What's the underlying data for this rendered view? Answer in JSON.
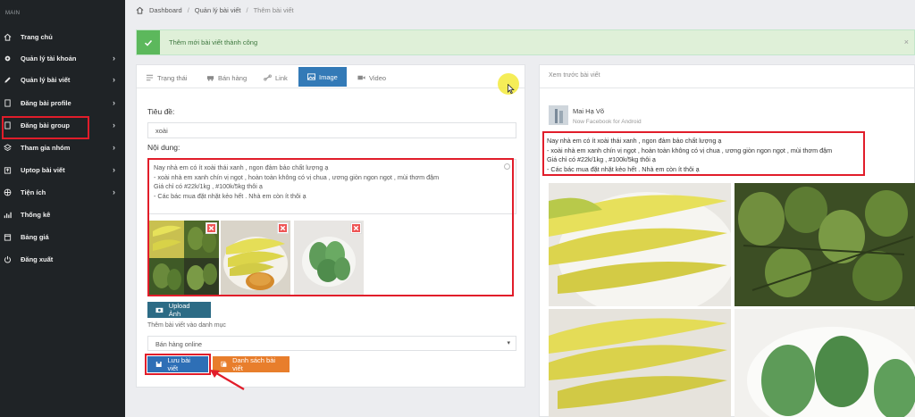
{
  "sidebar": {
    "section_label": "MAIN",
    "items": [
      {
        "label": "Trang chủ",
        "icon": "home-icon",
        "has_chevron": false
      },
      {
        "label": "Quản lý tài khoản",
        "icon": "gear-icon",
        "has_chevron": true
      },
      {
        "label": "Quản lý bài viết",
        "icon": "pencil-icon",
        "has_chevron": true
      },
      {
        "label": "Đăng bài profile",
        "icon": "document-icon",
        "has_chevron": true
      },
      {
        "label": "Đăng bài group",
        "icon": "document-icon",
        "has_chevron": true,
        "highlighted": true
      },
      {
        "label": "Tham gia nhóm",
        "icon": "layers-icon",
        "has_chevron": true
      },
      {
        "label": "Uptop bài viết",
        "icon": "upload-icon",
        "has_chevron": true
      },
      {
        "label": "Tiện ích",
        "icon": "globe-icon",
        "has_chevron": true
      },
      {
        "label": "Thống kê",
        "icon": "chart-icon",
        "has_chevron": false
      },
      {
        "label": "Bảng giá",
        "icon": "calendar-icon",
        "has_chevron": false
      },
      {
        "label": "Đăng xuất",
        "icon": "power-icon",
        "has_chevron": false
      }
    ]
  },
  "breadcrumb": {
    "home": "Dashboard",
    "section": "Quản lý bài viết",
    "current": "Thêm bài viết"
  },
  "alert": {
    "message": "Thêm mới bài viết thành công",
    "close": "×"
  },
  "tabs": [
    {
      "label": "Trạng thái",
      "icon": "status-icon"
    },
    {
      "label": "Bán hàng",
      "icon": "car-icon"
    },
    {
      "label": "Link",
      "icon": "link-icon"
    },
    {
      "label": "Image",
      "icon": "image-icon",
      "active": true
    },
    {
      "label": "Video",
      "icon": "video-icon"
    }
  ],
  "form": {
    "title_label": "Tiêu đề:",
    "title_value": "xoài",
    "content_label": "Nội dung:",
    "content_lines": [
      "Nay nhà em có ít xoài thái xanh  , ngon đảm bảo chất lượng ạ",
      "- xoài nhà em xanh chín vị ngọt , hoàn toàn không có vị chua , ương giòn ngon ngọt , mùi thơm đậm",
      "Giá chỉ có #22k/1kg , #100k/5kg  thôi ạ",
      "- Các bác mua đặt nhặt kẻo hết . Nhà em còn ít thôi ạ"
    ],
    "upload_label": "Upload Ảnh",
    "category_label": "Thêm bài viết vào danh mục",
    "category_value": "Bán hàng online",
    "save_label": "Lưu bài viết",
    "list_label": "Danh sách bài viết"
  },
  "preview": {
    "header": "Xem trước bài viết",
    "author": "Mai Hạ Võ",
    "meta": "Now  Facebook for Android",
    "lines": [
      "Nay nhà em có ít xoài thái xanh  , ngon đảm bảo chất lượng ạ",
      "- xoài nhà em xanh chín vị ngọt , hoàn toàn không có vị chua , ương giòn ngon ngọt , mùi thơm đậm",
      "Giá chỉ có #22k/1kg , #100k/5kg  thôi ạ",
      "- Các bác mua đặt nhặt kẻo hết . Nhà em còn ít thôi ạ"
    ]
  },
  "colors": {
    "sidebar_bg": "#1f2326",
    "primary": "#337ab7",
    "success": "#5cb85c",
    "warning": "#e87e2c",
    "annotation_red": "#e11d2a"
  }
}
